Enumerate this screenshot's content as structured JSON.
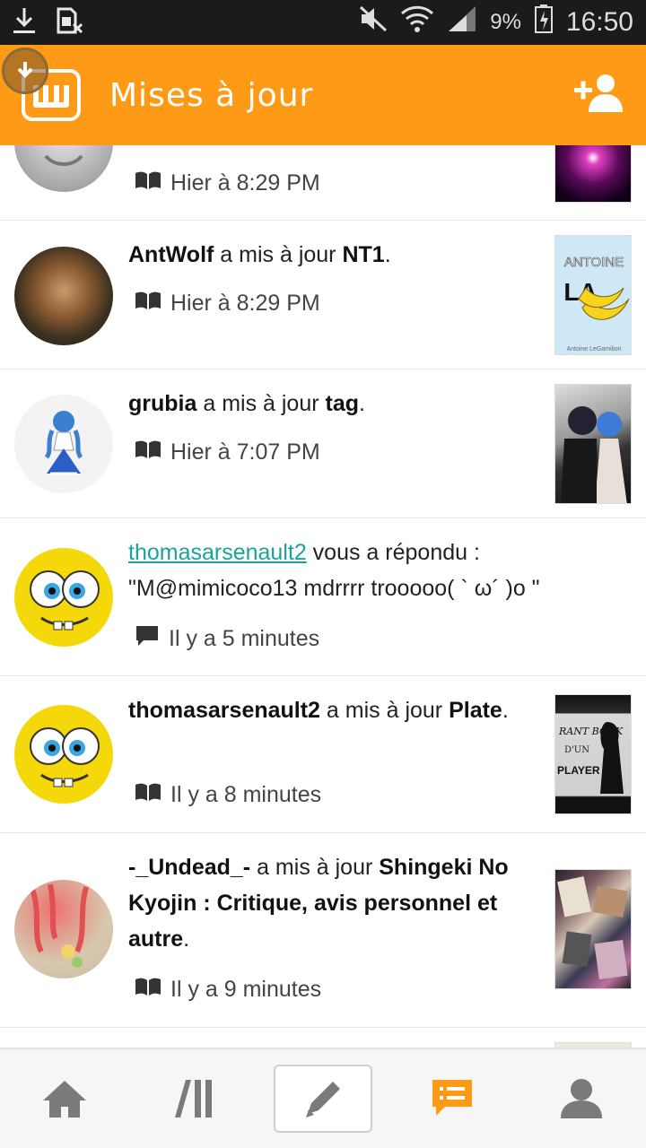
{
  "status_bar": {
    "battery_pct": "9%",
    "time": "16:50"
  },
  "app_bar": {
    "title": "Mises à jour"
  },
  "feed": [
    {
      "time": "Hier à 8:29 PM"
    },
    {
      "user": "AntWolf",
      "action": " a mis à jour ",
      "story": "NT1",
      "end": ".",
      "time": "Hier à 8:29 PM",
      "thumb_text": [
        "ANTOINE",
        "LA",
        "Antoine LeGamilion"
      ]
    },
    {
      "user": "grubia",
      "action": " a mis à jour ",
      "story": "tag",
      "end": ".",
      "time": "Hier à 7:07 PM"
    },
    {
      "user": "thomasarsenault2",
      "action": " vous a répondu :",
      "quote": "\"M@mimicoco13 mdrrrr trooooo( ` ω´ )o \"",
      "time": "Il y a 5 minutes"
    },
    {
      "user": "thomasarsenault2",
      "action": " a mis à jour ",
      "story": "Plate",
      "end": ".",
      "time": "Il y a 8 minutes",
      "thumb_text": [
        "RANT BOOK",
        "D'UN",
        "PLAYER"
      ]
    },
    {
      "user": "-_Undead_-",
      "action": " a mis à jour ",
      "story": "Shingeki No Kyojin : Critique, avis personnel et autre",
      "end": ".",
      "time": "Il y a 9 minutes"
    }
  ],
  "colors": {
    "accent": "#ff9a16",
    "link": "#1aa39a",
    "active_tab": "#ff9a16",
    "icon": "#7a7a7a"
  },
  "tabs": [
    "home-icon",
    "library-icon",
    "write-icon",
    "notifications-icon",
    "profile-icon"
  ]
}
